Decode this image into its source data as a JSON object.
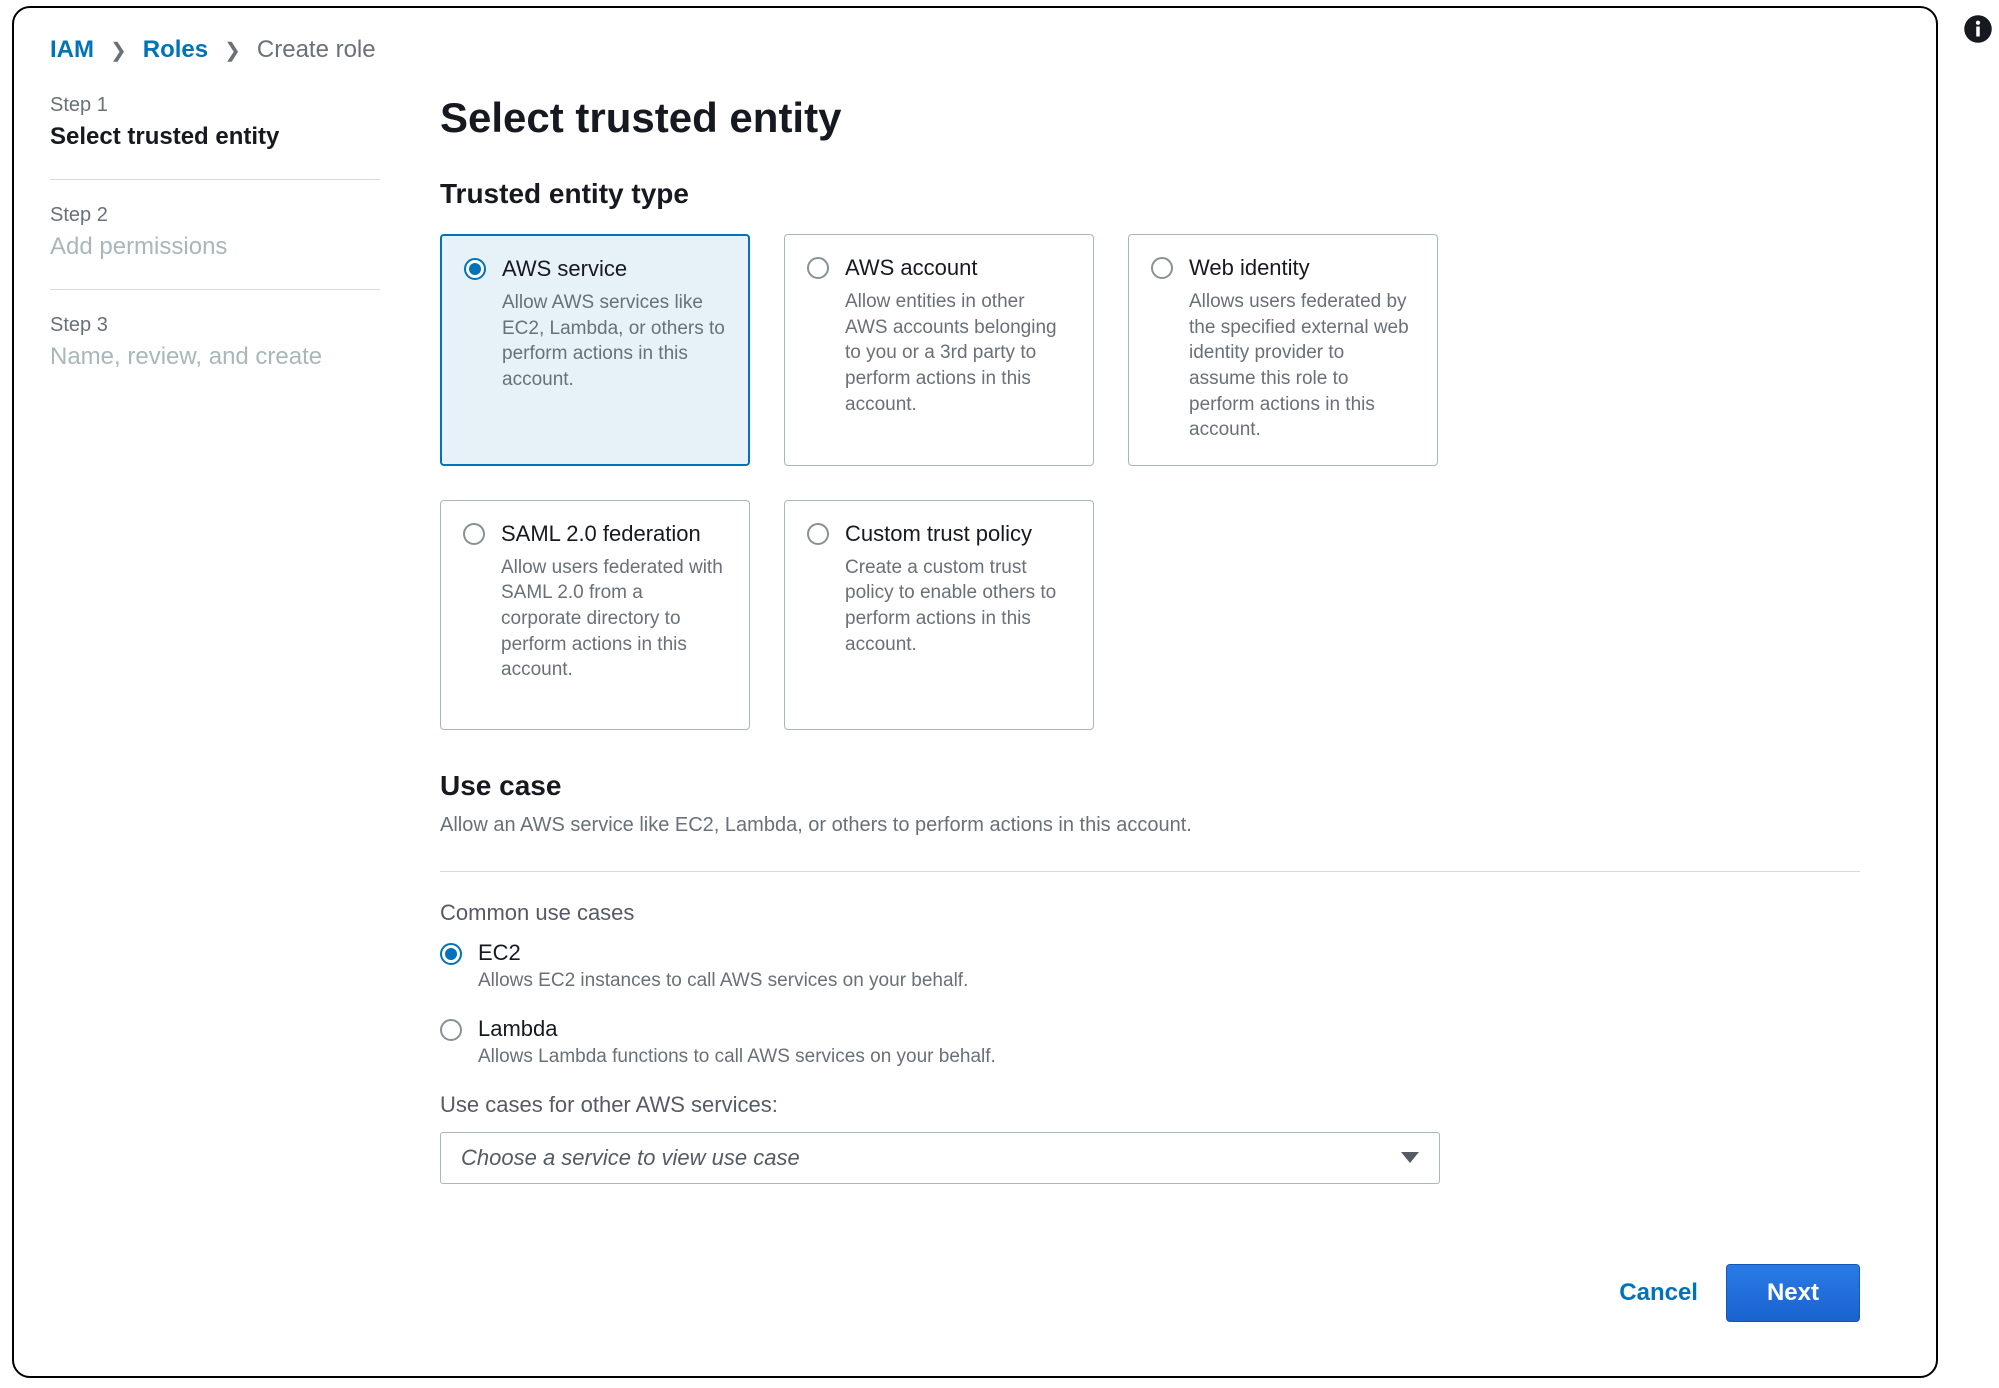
{
  "breadcrumb": {
    "root": "IAM",
    "section": "Roles",
    "current": "Create role"
  },
  "steps": [
    {
      "label": "Step 1",
      "title": "Select trusted entity",
      "active": true
    },
    {
      "label": "Step 2",
      "title": "Add permissions",
      "active": false
    },
    {
      "label": "Step 3",
      "title": "Name, review, and create",
      "active": false
    }
  ],
  "page": {
    "title": "Select trusted entity",
    "entity_type_heading": "Trusted entity type"
  },
  "entity_types": [
    {
      "title": "AWS service",
      "desc": "Allow AWS services like EC2, Lambda, or others to perform actions in this account.",
      "selected": true
    },
    {
      "title": "AWS account",
      "desc": "Allow entities in other AWS accounts belonging to you or a 3rd party to perform actions in this account.",
      "selected": false
    },
    {
      "title": "Web identity",
      "desc": "Allows users federated by the specified external web identity provider to assume this role to perform actions in this account.",
      "selected": false
    },
    {
      "title": "SAML 2.0 federation",
      "desc": "Allow users federated with SAML 2.0 from a corporate directory to perform actions in this account.",
      "selected": false
    },
    {
      "title": "Custom trust policy",
      "desc": "Create a custom trust policy to enable others to perform actions in this account.",
      "selected": false
    }
  ],
  "use_case": {
    "heading": "Use case",
    "sub": "Allow an AWS service like EC2, Lambda, or others to perform actions in this account.",
    "common_heading": "Common use cases",
    "options": [
      {
        "title": "EC2",
        "desc": "Allows EC2 instances to call AWS services on your behalf.",
        "selected": true
      },
      {
        "title": "Lambda",
        "desc": "Allows Lambda functions to call AWS services on your behalf.",
        "selected": false
      }
    ],
    "other_heading": "Use cases for other AWS services:",
    "dropdown_placeholder": "Choose a service to view use case"
  },
  "footer": {
    "cancel": "Cancel",
    "next": "Next"
  }
}
